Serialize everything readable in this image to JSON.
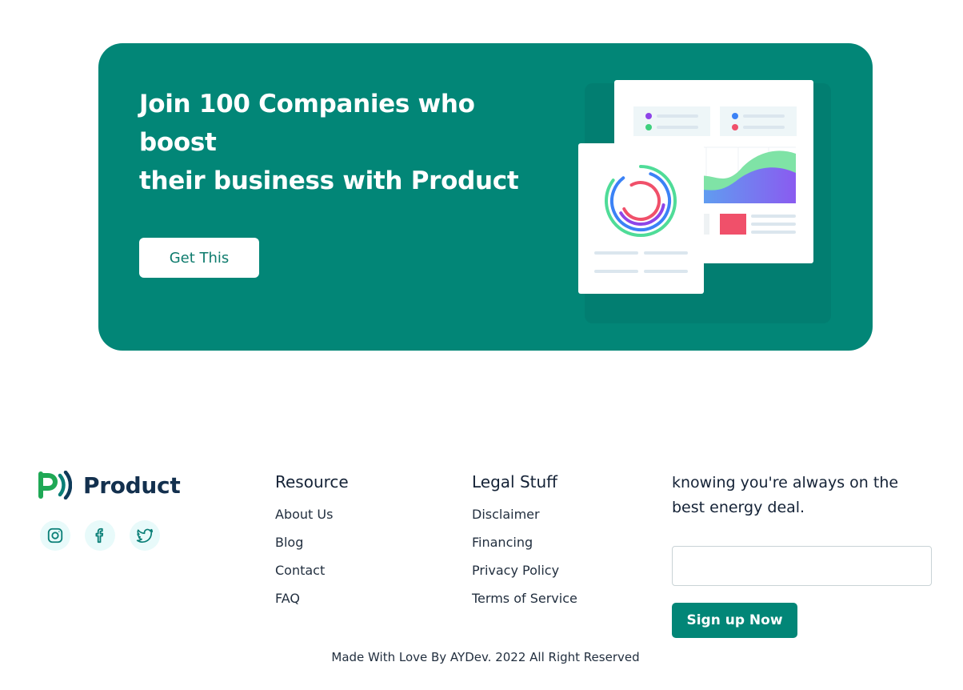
{
  "cta": {
    "title_line1": "Join 100 Companies who boost",
    "title_line2": "their business with Product",
    "button_label": "Get This",
    "background_color": "#028677"
  },
  "footer": {
    "brand": {
      "name": "Product",
      "logo_icon": "product-logo-icon"
    },
    "socials": [
      {
        "icon": "instagram-icon"
      },
      {
        "icon": "facebook-icon"
      },
      {
        "icon": "twitter-icon"
      }
    ],
    "resource": {
      "title": "Resource",
      "links": [
        "About Us",
        "Blog",
        "Contact",
        "FAQ"
      ]
    },
    "legal": {
      "title": "Legal Stuff",
      "links": [
        "Disclaimer",
        "Financing",
        "Privacy Policy",
        "Terms of Service"
      ]
    },
    "newsletter": {
      "text_line1": "knowing you're always on the",
      "text_line2": "best energy deal.",
      "input_value": "",
      "button_label": "Sign up Now"
    },
    "copyright": "Made With Love By AYDev. 2022 All Right Reserved"
  },
  "colors": {
    "accent": "#028677",
    "brand_text": "#13304e",
    "social_bg": "#e8fafa"
  }
}
